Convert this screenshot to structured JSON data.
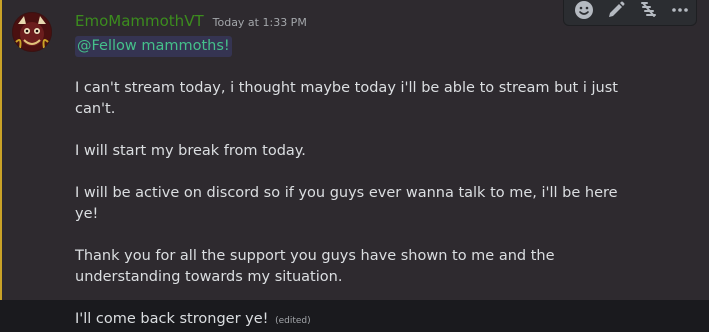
{
  "message": {
    "author": "EmoMammothVT",
    "timestamp": "Today at 1:33 PM",
    "mention": "@Fellow mammoths!",
    "lines": [
      "I can't stream today, i thought maybe today i'll be able to stream but i just can't.",
      "I will start my break from today.",
      "I will be active on discord so if you guys ever wanna talk to me, i'll be here ye!",
      "Thank you for all the support you guys have shown to me and the understanding towards my situation.",
      "I'll come back stronger ye!"
    ],
    "edited_label": "(edited)"
  },
  "toolbar": {
    "icons": [
      "emoji-reaction-icon",
      "edit-pencil-icon",
      "super-reaction-icon",
      "more-options-icon"
    ]
  },
  "colors": {
    "username": "#3c8c1e",
    "mention_text": "#45c08a",
    "mention_bar": "#c9a227",
    "message_bg": "#2e2a2f"
  }
}
